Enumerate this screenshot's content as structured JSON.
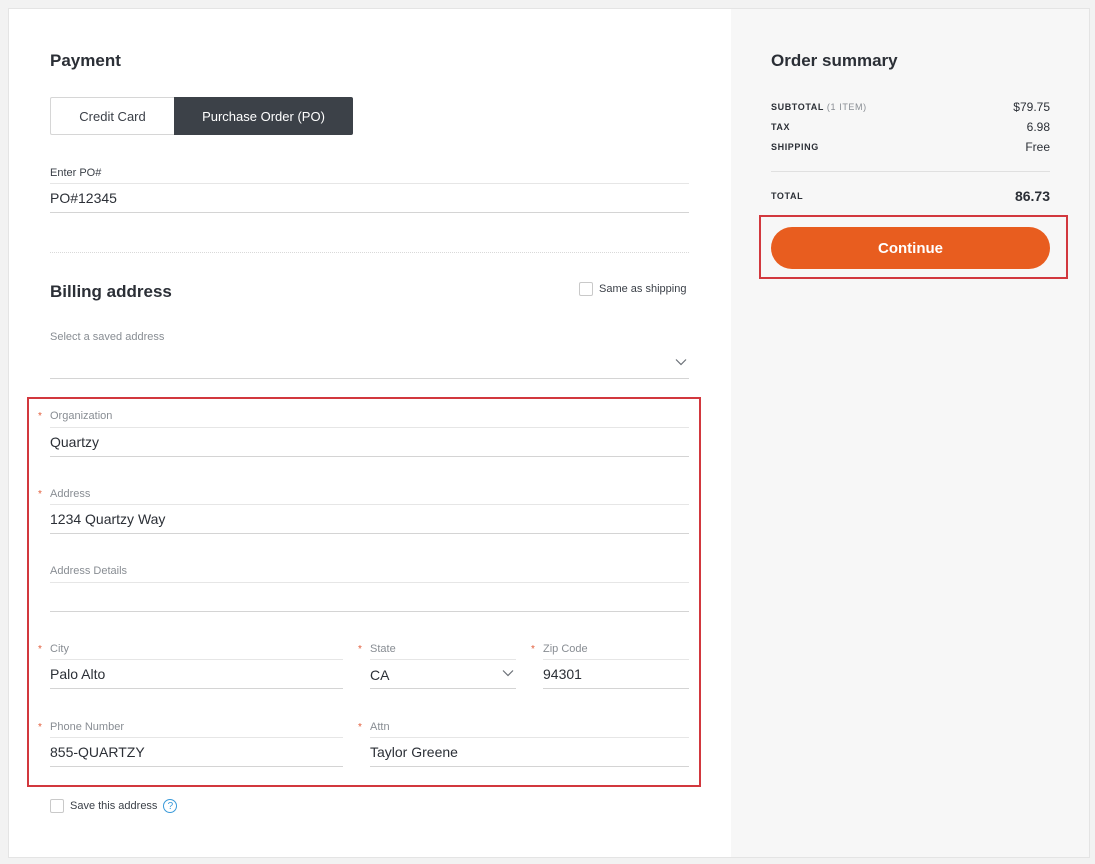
{
  "payment": {
    "title": "Payment",
    "tabs": [
      {
        "label": "Credit Card",
        "active": false
      },
      {
        "label": "Purchase Order (PO)",
        "active": true
      }
    ],
    "po": {
      "label": "Enter PO#",
      "value": "PO#12345"
    }
  },
  "billing": {
    "title": "Billing address",
    "same_as_shipping": "Same as shipping",
    "saved_address": {
      "label": "Select a saved address",
      "value": ""
    },
    "fields": {
      "organization": {
        "label": "Organization",
        "value": "Quartzy",
        "required": "*"
      },
      "address": {
        "label": "Address",
        "value": "1234 Quartzy Way",
        "required": "*"
      },
      "address_details": {
        "label": "Address Details",
        "value": ""
      },
      "city": {
        "label": "City",
        "value": "Palo Alto",
        "required": "*"
      },
      "state": {
        "label": "State",
        "value": "CA",
        "required": "*"
      },
      "zip": {
        "label": "Zip Code",
        "value": "94301",
        "required": "*"
      },
      "phone": {
        "label": "Phone Number",
        "value": "855-QUARTZY",
        "required": "*"
      },
      "attn": {
        "label": "Attn",
        "value": "Taylor Greene",
        "required": "*"
      }
    },
    "save_address": "Save this address",
    "help": "?"
  },
  "summary": {
    "title": "Order summary",
    "subtotal_label": "SUBTOTAL",
    "subtotal_items": "(1 ITEM)",
    "subtotal_value": "$79.75",
    "tax_label": "TAX",
    "tax_value": "6.98",
    "shipping_label": "SHIPPING",
    "shipping_value": "Free",
    "total_label": "TOTAL",
    "total_value": "86.73",
    "continue_label": "Continue"
  },
  "colors": {
    "accent": "#e85d1f",
    "highlight": "#d2383e",
    "active_tab": "#3c4148",
    "help": "#3a9ad9"
  }
}
